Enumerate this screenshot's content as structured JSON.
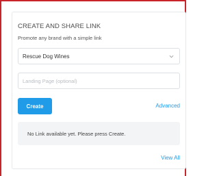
{
  "panel": {
    "title": "CREATE AND SHARE LINK",
    "subtitle": "Promote any brand with a simple link"
  },
  "brand_select": {
    "value": "Rescue Dog Wines",
    "icon": "chevron-down-icon"
  },
  "landing_page": {
    "value": "",
    "placeholder": "Landing Page (optional)"
  },
  "actions": {
    "create_label": "Create",
    "advanced_label": "Advanced"
  },
  "empty_state": {
    "message": "No Link available yet. Please press Create."
  },
  "footer": {
    "view_all_label": "View All"
  },
  "colors": {
    "accent": "#1f9be8",
    "frame_border": "#c8242a",
    "empty_bg": "#f3f4f6"
  }
}
